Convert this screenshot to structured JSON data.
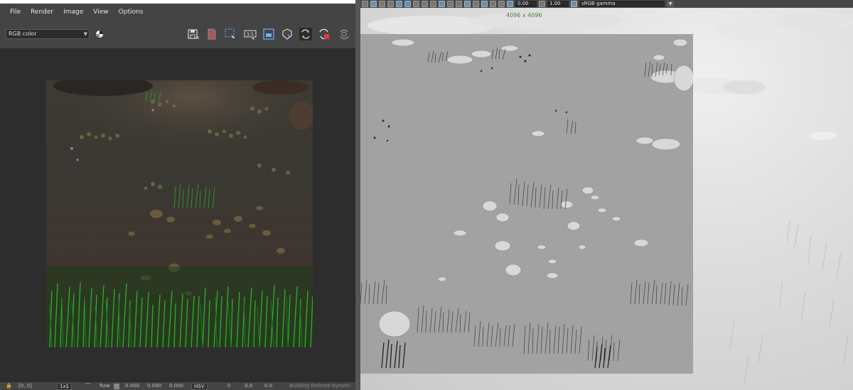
{
  "render_view": {
    "menu": [
      "File",
      "Render",
      "Image",
      "View",
      "Options"
    ],
    "channel_display": "RGB color",
    "toolbar_icons": [
      "save-image-icon",
      "remove-image-icon",
      "region-select-icon",
      "real-size-icon",
      "frame-image-icon",
      "snapshot-icon",
      "ipr-render-icon",
      "render-stop-icon",
      "render-settings-icon"
    ],
    "toolbar_labels": {
      "real_size": "1:1"
    },
    "status": {
      "pixel_coords": "[0, 0]",
      "zoom": "1x1",
      "raw_label": "Raw",
      "raw_values": [
        "0.000",
        "0.000",
        "0.000"
      ],
      "color_mode": "HSV",
      "hsv_values": [
        "0",
        "0.0",
        "0.0"
      ],
      "message": "Building Embree dynami"
    }
  },
  "viewport": {
    "exposure_value": "0.00",
    "gamma_value": "1.00",
    "color_space": "sRGB gamma",
    "resolution": "4096 x 4096"
  },
  "colors": {
    "window_bg": "#444444",
    "image_frame_bg": "#2d2d2d",
    "viewport_bg": "#d6d6d6",
    "resolution_text": "#4a7a3d",
    "grass_green": "#2ea02a"
  }
}
